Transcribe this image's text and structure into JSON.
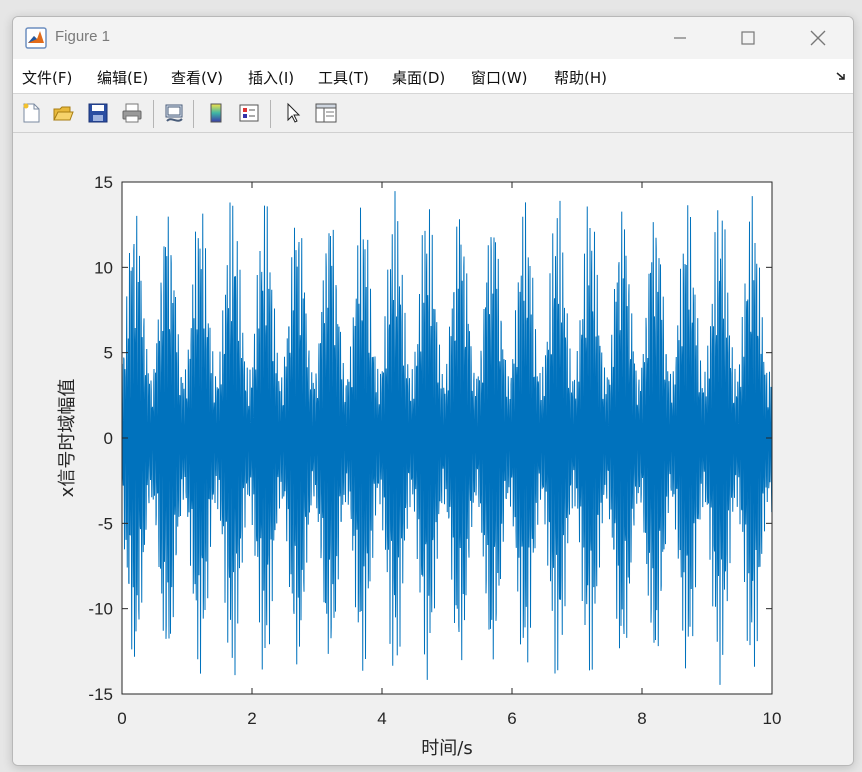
{
  "window": {
    "title": "Figure 1"
  },
  "menu": [
    {
      "label": "文件(F)"
    },
    {
      "label": "编辑(E)"
    },
    {
      "label": "查看(V)"
    },
    {
      "label": "插入(I)"
    },
    {
      "label": "工具(T)"
    },
    {
      "label": "桌面(D)"
    },
    {
      "label": "窗口(W)"
    },
    {
      "label": "帮助(H)"
    }
  ],
  "toolbar": [
    "new-figure-icon",
    "open-file-icon",
    "save-icon",
    "print-icon",
    "link-plot-icon",
    "colorbar-icon",
    "legend-icon",
    "edit-plot-arrow-icon",
    "property-inspector-icon"
  ],
  "colors": {
    "line": "#0072BD",
    "axes_bg": "#ffffff",
    "figure_bg": "#f0f0f0"
  },
  "chart_data": {
    "type": "line",
    "title": "",
    "xlabel": "时间/s",
    "ylabel": "x信号时域幅值",
    "xlim": [
      0,
      10
    ],
    "ylim": [
      -15,
      15
    ],
    "xticks": [
      0,
      2,
      4,
      6,
      8,
      10
    ],
    "yticks": [
      -15,
      -10,
      -5,
      0,
      5,
      10,
      15
    ],
    "grid": false,
    "series": [
      {
        "color": "#0072BD",
        "description": "dense beating oscillation",
        "envelope_peaks_x": [
          0.2,
          0.7,
          1.2,
          1.7,
          2.2,
          2.7,
          3.2,
          3.7,
          4.2,
          4.7,
          5.2,
          5.7,
          6.2,
          6.7,
          7.2,
          7.7,
          8.2,
          8.7,
          9.2,
          9.7
        ],
        "peak_amplitude": 14.5,
        "min_envelope_amplitude": 4
      }
    ]
  }
}
